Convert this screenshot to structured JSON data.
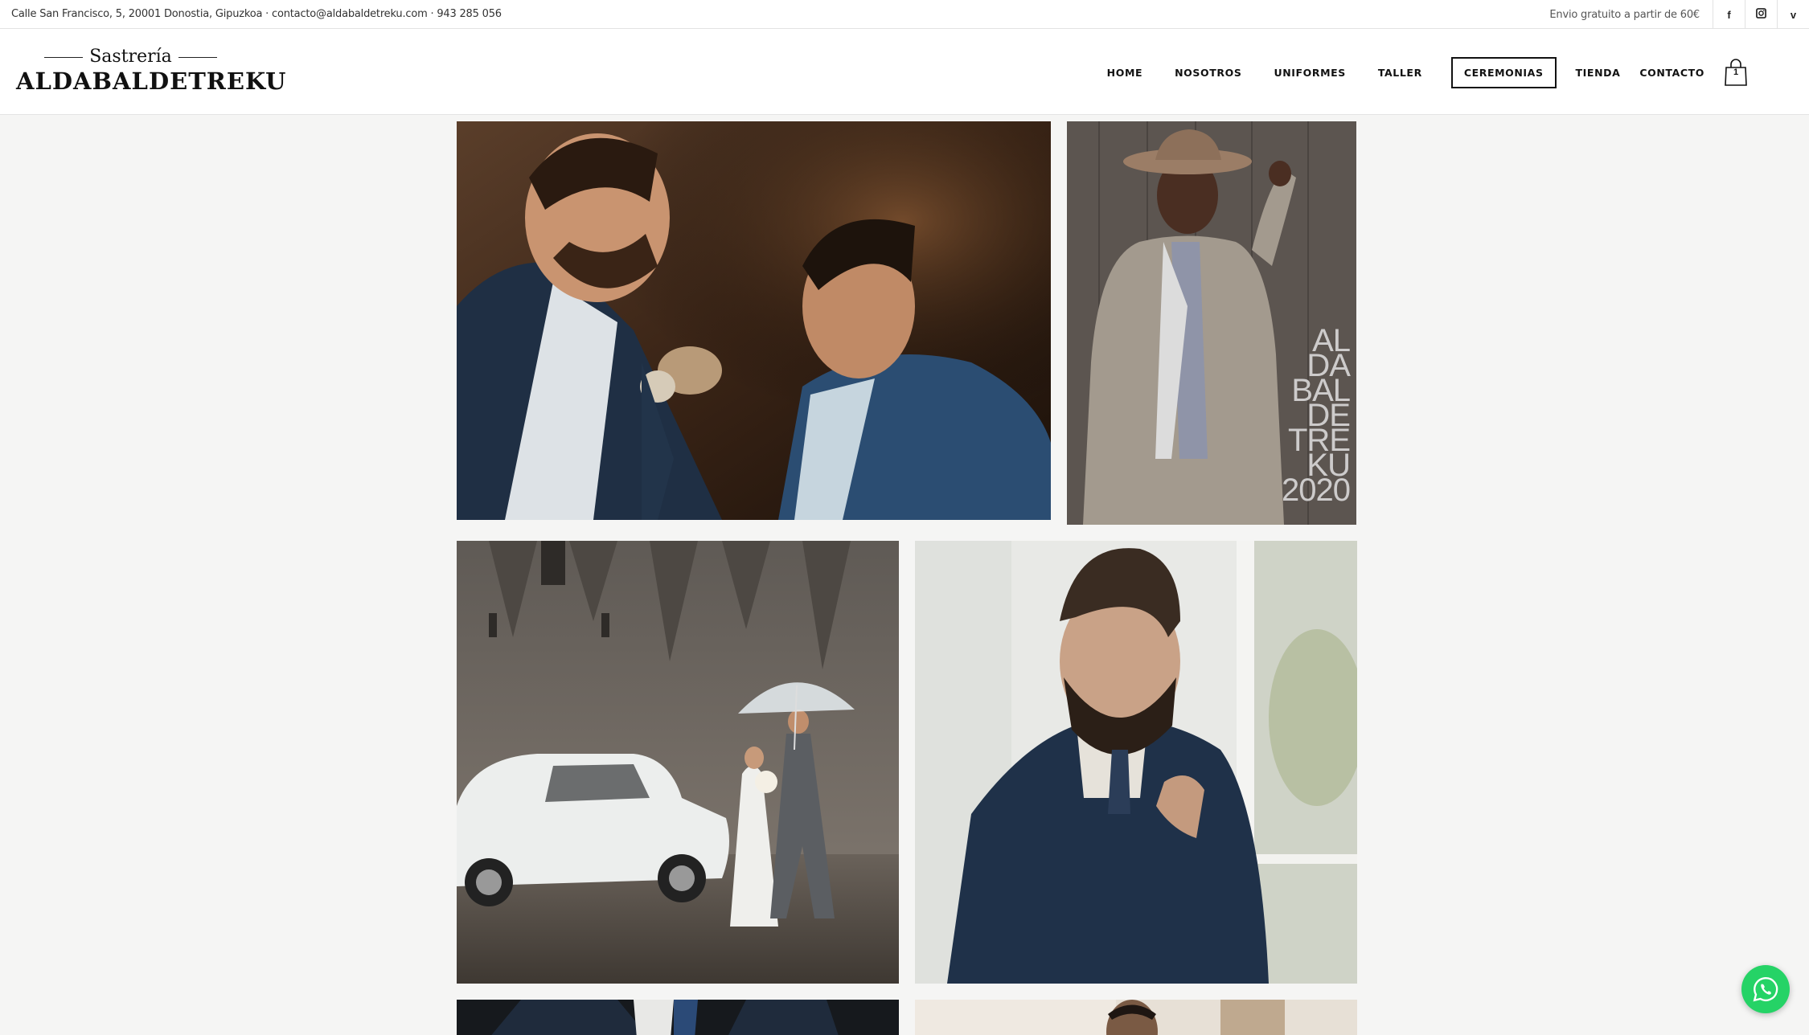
{
  "topbar": {
    "address": "Calle San Francisco, 5, 20001 Donostia, Gipuzkoa · contacto@aldabaldetreku.com · 943 285 056",
    "shipping": "Envio gratuito a partir de 60€",
    "social": [
      {
        "icon": "facebook-icon",
        "glyph": "f"
      },
      {
        "icon": "instagram-icon",
        "glyph": ""
      },
      {
        "icon": "vimeo-icon",
        "glyph": "v"
      }
    ]
  },
  "logo": {
    "top": "Sastrería",
    "main": "ALDABALDETREKU"
  },
  "nav": {
    "items": [
      "HOME",
      "NOSOTROS",
      "UNIFORMES",
      "TALLER",
      "CEREMONIAS",
      "TIENDA",
      "CONTACTO"
    ],
    "active": "CEREMONIAS"
  },
  "cart": {
    "count": "1"
  },
  "gallery": {
    "watermark": [
      "AL",
      "DA",
      "BAL",
      "DE",
      "TRE",
      "KU",
      "2020"
    ]
  },
  "colors": {
    "whatsapp": "#25d366",
    "text": "#222222",
    "background": "#f5f5f4"
  }
}
